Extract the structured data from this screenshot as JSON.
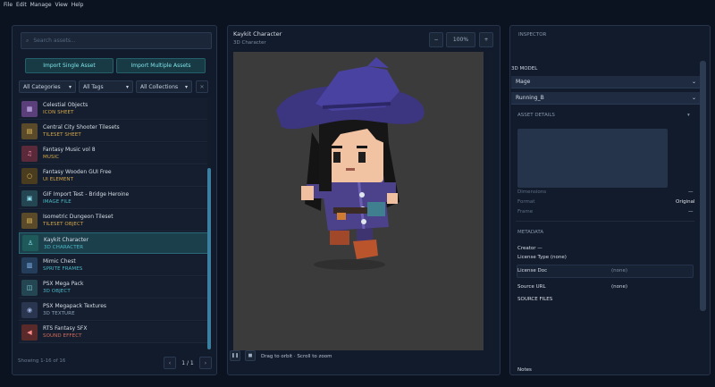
{
  "menu": [
    "File",
    "Edit",
    "Manage",
    "View",
    "Help"
  ],
  "left": {
    "search_placeholder": "Search assets...",
    "import_single": "Import Single Asset",
    "import_multiple": "Import Multiple Assets",
    "filters": {
      "categories": "All Categories",
      "tags": "All Tags",
      "collections": "All Collections"
    },
    "items": [
      {
        "name": "Celestial Objects",
        "type": "ICON SHEET",
        "type_color": "#d4a64a",
        "icon": "grid-icon",
        "glyph": "▦",
        "bg": "#5a3f7a",
        "fg": "#d7c2ff"
      },
      {
        "name": "Central City Shooter Tilesets",
        "type": "TILESET SHEET",
        "type_color": "#d4a64a",
        "icon": "tiles-icon",
        "glyph": "▤",
        "bg": "#5a4a2a",
        "fg": "#f0c860"
      },
      {
        "name": "Fantasy Music vol 8",
        "type": "MUSIC",
        "type_color": "#d4a64a",
        "icon": "music-note-icon",
        "glyph": "♫",
        "bg": "#5a2a3a",
        "fg": "#ff8fae"
      },
      {
        "name": "Fantasy Wooden GUI Free",
        "type": "UI ELEMENT",
        "type_color": "#d4a64a",
        "icon": "circle-icon",
        "glyph": "○",
        "bg": "#4a3d1f",
        "fg": "#f0c860"
      },
      {
        "name": "GIF Import Test - Bridge Heroine",
        "type": "IMAGE FILE",
        "type_color": "#4bb8c7",
        "icon": "image-icon",
        "glyph": "▣",
        "bg": "#234652",
        "fg": "#8fe0ef"
      },
      {
        "name": "Isometric Dungeon Tileset",
        "type": "TILESET OBJECT",
        "type_color": "#d4a64a",
        "icon": "tiles-icon",
        "glyph": "▤",
        "bg": "#5a4a2a",
        "fg": "#f0c860"
      },
      {
        "name": "Kaykit Character",
        "type": "3D CHARACTER",
        "type_color": "#4bb8c7",
        "icon": "character-icon",
        "glyph": "♙",
        "bg": "#1f5a5a",
        "fg": "#8fe0ef",
        "selected": true
      },
      {
        "name": "Mimic Chest",
        "type": "SPRITE FRAMES",
        "type_color": "#4bb8c7",
        "icon": "frames-icon",
        "glyph": "▥",
        "bg": "#233d5a",
        "fg": "#8fc4ff"
      },
      {
        "name": "PSX Mega Pack",
        "type": "3D OBJECT",
        "type_color": "#4bb8c7",
        "icon": "cube-icon",
        "glyph": "◫",
        "bg": "#234652",
        "fg": "#8fe0ef"
      },
      {
        "name": "PSX Megapack Textures",
        "type": "3D TEXTURE",
        "type_color": "#8aa0b8",
        "icon": "texture-icon",
        "glyph": "◉",
        "bg": "#2a3550",
        "fg": "#a0b4e0"
      },
      {
        "name": "RTS Fantasy SFX",
        "type": "SOUND EFFECT",
        "type_color": "#d46a5a",
        "icon": "speaker-icon",
        "glyph": "◀",
        "bg": "#5a2a2a",
        "fg": "#ff8f8f"
      }
    ],
    "showing": "Showing 1-16 of 16",
    "page": "1 / 1"
  },
  "center": {
    "title": "Kaykit Character",
    "subtitle": "3D Character",
    "zoom": "100%",
    "hint": "Drag to orbit · Scroll to zoom"
  },
  "inspector": {
    "heading": "INSPECTOR",
    "model_label": "3D MODEL",
    "model": "Mage",
    "animation": "Running_B",
    "details_heading": "ASSET DETAILS",
    "dimensions_label": "Dimensions",
    "dimensions_value": "—",
    "format_label": "Format",
    "format_value": "Original",
    "frame_label": "Frame",
    "frame_value": "—",
    "metadata_heading": "METADATA",
    "creator_label": "Creator —",
    "license_type_label": "License Type (none)",
    "license_doc_label": "License Doc",
    "license_doc_value": "(none)",
    "source_url_label": "Source URL",
    "source_url_value": "(none)",
    "source_files_label": "SOURCE FILES",
    "notes_label": "Notes"
  }
}
